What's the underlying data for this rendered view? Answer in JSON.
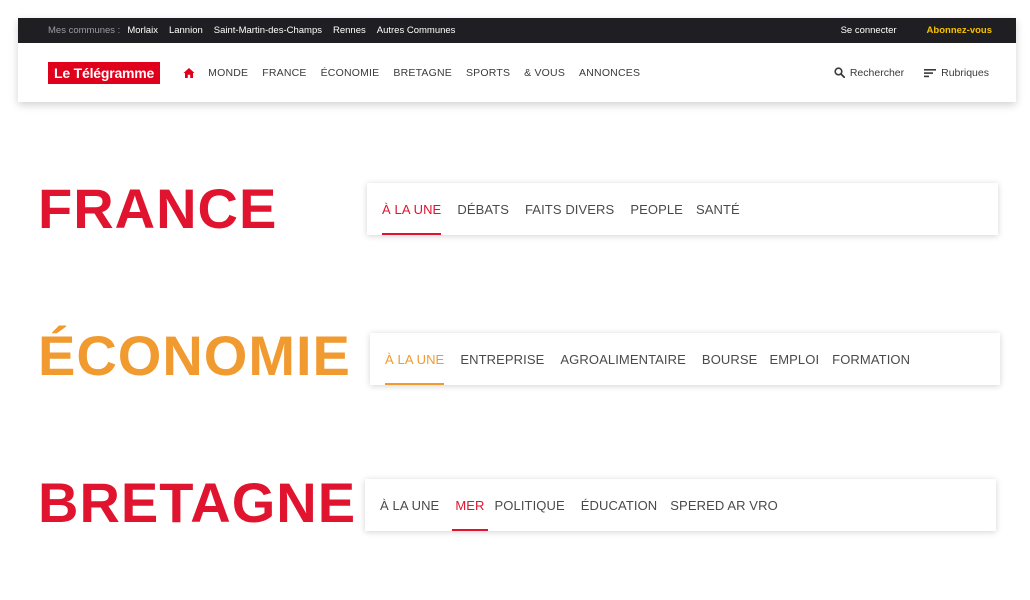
{
  "colors": {
    "brand_red": "#e0001b",
    "france": "#e0142e",
    "economie": "#f09a30",
    "bretagne": "#e0142e",
    "subscribe": "#f6c200"
  },
  "topbar": {
    "communes_label": "Mes communes :",
    "communes": [
      "Morlaix",
      "Lannion",
      "Saint-Martin-des-Champs",
      "Rennes",
      "Autres Communes"
    ],
    "login": "Se connecter",
    "subscribe": "Abonnez-vous"
  },
  "nav": {
    "logo": "Le Télégramme",
    "home_icon": "home-icon",
    "links": [
      "MONDE",
      "FRANCE",
      "ÉCONOMIE",
      "BRETAGNE",
      "SPORTS",
      "& VOUS",
      "ANNONCES"
    ],
    "search": "Rechercher",
    "search_icon": "search-icon",
    "rubriques": "Rubriques",
    "rubriques_icon": "menu-icon"
  },
  "sections": [
    {
      "title": "FRANCE",
      "color_key": "france",
      "active": 0,
      "tabs": [
        "À LA UNE",
        "DÉBATS",
        "FAITS DIVERS",
        "PEOPLE",
        "SANTÉ"
      ]
    },
    {
      "title": "ÉCONOMIE",
      "color_key": "economie",
      "active": 0,
      "tabs": [
        "À LA UNE",
        "ENTREPRISE",
        "AGROALIMENTAIRE",
        "BOURSE",
        "EMPLOI",
        "FORMATION"
      ]
    },
    {
      "title": "BRETAGNE",
      "color_key": "bretagne",
      "active": 1,
      "tabs": [
        "À LA UNE",
        "MER",
        "POLITIQUE",
        "ÉDUCATION",
        "SPERED AR VRO"
      ]
    }
  ]
}
